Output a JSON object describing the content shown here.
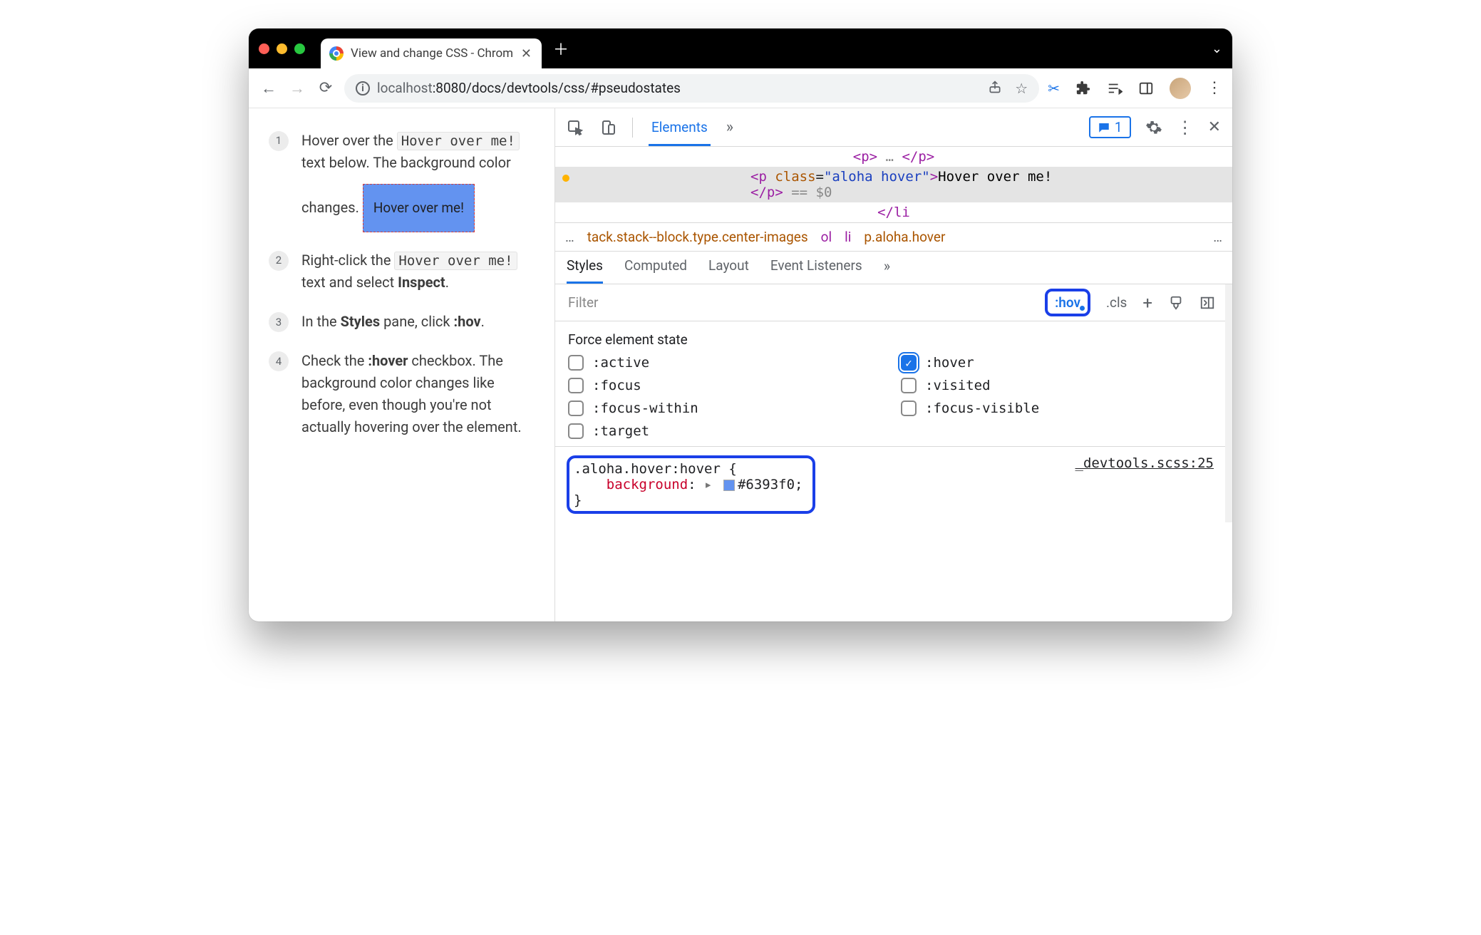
{
  "window": {
    "tab_title": "View and change CSS - Chrom",
    "chevron": "⌄"
  },
  "toolbar": {
    "url_host_dim": "localhost",
    "url_port": ":8080",
    "url_path": "/docs/devtools/css/#pseudostates"
  },
  "page": {
    "steps": [
      {
        "num": "1",
        "pre": "Hover over the ",
        "code": "Hover over me!",
        "post": " text below. The background color changes."
      },
      {
        "num": "2",
        "pre": "Right-click the ",
        "code": "Hover over me!",
        "post": " text and select ",
        "bold": "Inspect",
        "post2": "."
      },
      {
        "num": "3",
        "pre": "In the ",
        "bold": "Styles",
        "mid": " pane, click ",
        "bold2": ":hov",
        "post": "."
      },
      {
        "num": "4",
        "pre": "Check the ",
        "bold": ":hover",
        "post": " checkbox. The background color changes like before, even though you're not actually hovering over the element."
      }
    ],
    "hover_demo": "Hover over me!"
  },
  "devtools": {
    "top_tabs": {
      "active": "Elements"
    },
    "issues_count": "1",
    "dom": {
      "above": "p … /p",
      "sel_open": "<p class=\"aloha hover\">",
      "sel_text": "Hover over me!",
      "sel_close": "</p>",
      "eq": " == $0",
      "below": "</li"
    },
    "crumbs": [
      "…",
      "tack.stack--block.type.center-images",
      "ol",
      "li",
      "p.aloha.hover",
      "…"
    ],
    "subtabs": [
      "Styles",
      "Computed",
      "Layout",
      "Event Listeners"
    ],
    "subtabs_active": "Styles",
    "filter_placeholder": "Filter",
    "hov_label": ":hov",
    "cls_label": ".cls",
    "force_title": "Force element state",
    "states": [
      {
        "label": ":active",
        "checked": false
      },
      {
        "label": ":hover",
        "checked": true
      },
      {
        "label": ":focus",
        "checked": false
      },
      {
        "label": ":visited",
        "checked": false
      },
      {
        "label": ":focus-within",
        "checked": false
      },
      {
        "label": ":focus-visible",
        "checked": false
      },
      {
        "label": ":target",
        "checked": false
      }
    ],
    "rule": {
      "selector": ".aloha.hover:hover {",
      "prop": "background",
      "value": "#6393f0",
      "close": "}",
      "source": "_devtools.scss:25"
    }
  }
}
